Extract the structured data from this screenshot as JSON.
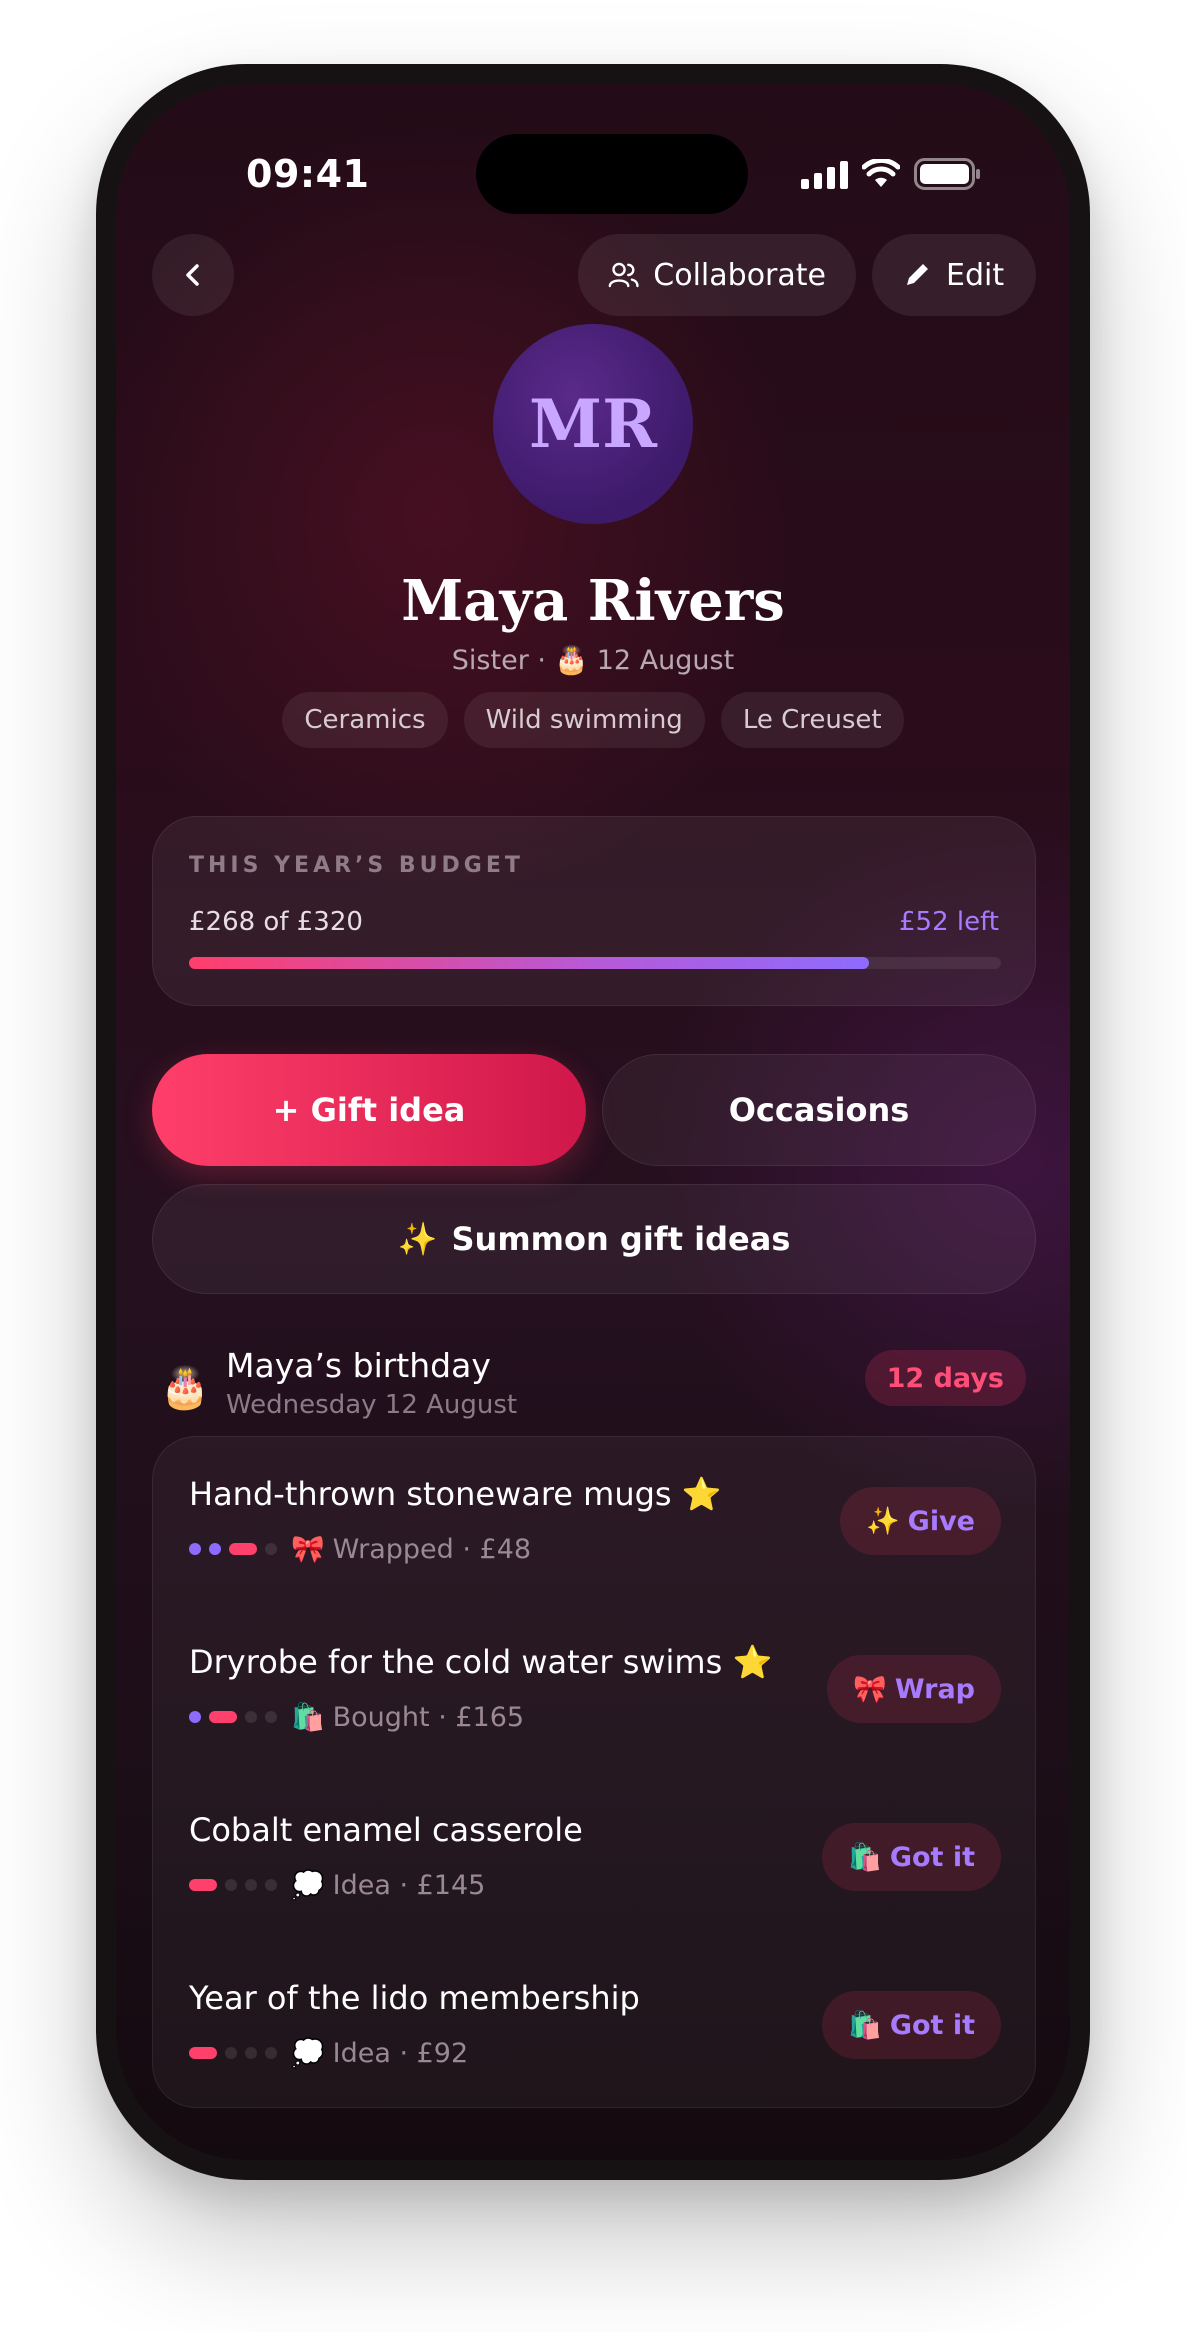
{
  "status": {
    "time": "09:41"
  },
  "header": {
    "back_icon": "chevron-left-icon",
    "collaborate_label": "Collaborate",
    "edit_label": "Edit"
  },
  "profile": {
    "initials": "MR",
    "name": "Maya Rivers",
    "subline": "Sister · 🎂 12 August",
    "tags": [
      "Ceramics",
      "Wild swimming",
      "Le Creuset"
    ]
  },
  "budget": {
    "label": "THIS YEAR’S BUDGET",
    "spent_text": "£268 of £320",
    "left_text": "£52 left",
    "spent": 268,
    "total": 320
  },
  "actions": {
    "gift_idea_label": "+ Gift idea",
    "occasions_label": "Occasions",
    "summon_label": "Summon gift ideas",
    "summon_emoji": "✨"
  },
  "occasion": {
    "emoji": "🎂",
    "title": "Maya’s birthday",
    "date": "Wednesday 12 August",
    "countdown": "12 days"
  },
  "gifts": [
    {
      "title": "Hand-thrown stoneware mugs ⭐",
      "stage": 3,
      "status_emoji": "🎀",
      "status": "Wrapped · £48",
      "action_emoji": "✨",
      "action": "Give"
    },
    {
      "title": "Dryrobe for the cold water swims ⭐",
      "stage": 2,
      "status_emoji": "🛍️",
      "status": "Bought · £165",
      "action_emoji": "🎀",
      "action": "Wrap"
    },
    {
      "title": "Cobalt enamel casserole",
      "stage": 1,
      "status_emoji": "💭",
      "status": "Idea · £145",
      "action_emoji": "🛍️",
      "action": "Got it"
    },
    {
      "title": "Year of the lido membership",
      "stage": 1,
      "status_emoji": "💭",
      "status": "Idea · £92",
      "action_emoji": "🛍️",
      "action": "Got it"
    }
  ],
  "colors": {
    "accent_pink": "#ff3f6c",
    "accent_purple": "#8e6bff"
  }
}
